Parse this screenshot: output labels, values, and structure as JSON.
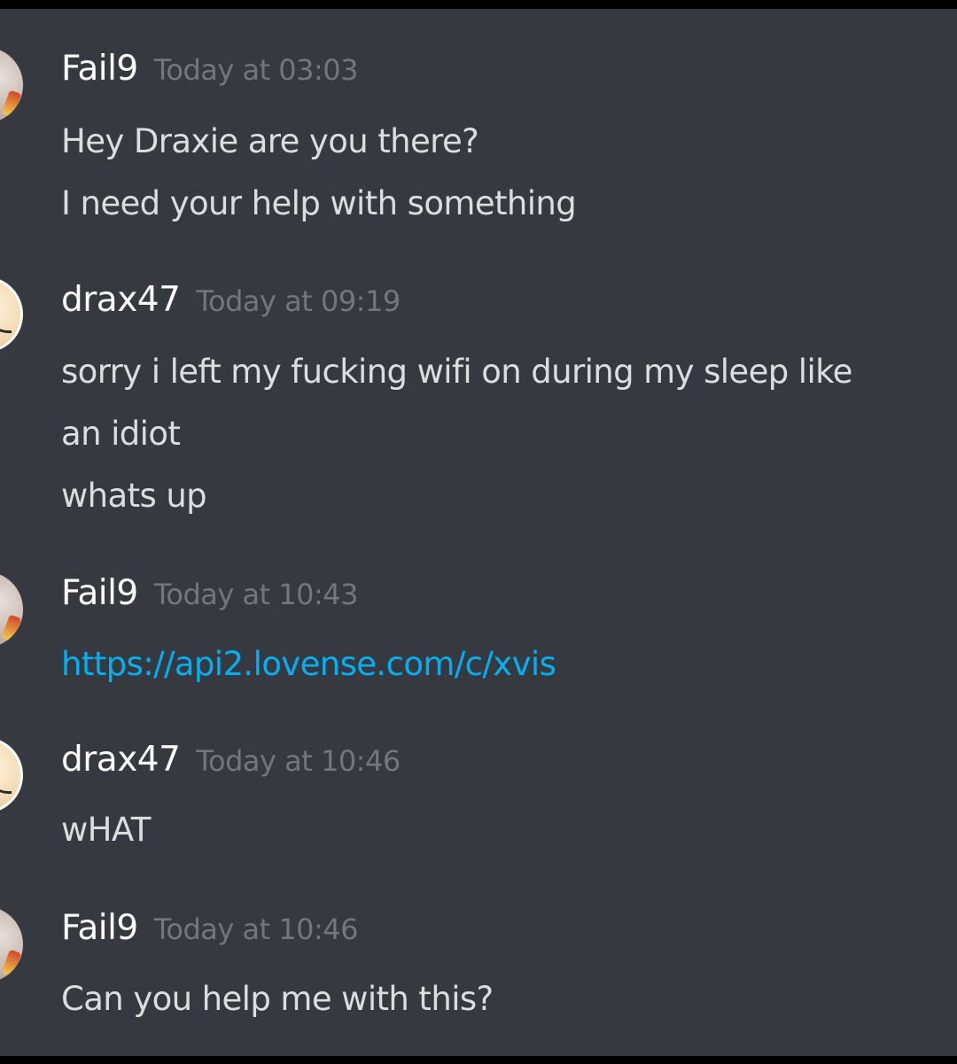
{
  "messages": [
    {
      "username": "Fail9",
      "timestamp": "Today at 03:03",
      "avatar": "user-avatar-fail9",
      "lines": [
        "Hey Draxie are you there?",
        "I need your help with something"
      ]
    },
    {
      "username": "drax47",
      "timestamp": "Today at 09:19",
      "avatar": "user-avatar-drax47",
      "lines": [
        "sorry i left my fucking wifi on during my sleep like",
        "an idiot",
        "whats up"
      ]
    },
    {
      "username": "Fail9",
      "timestamp": "Today at 10:43",
      "avatar": "user-avatar-fail9",
      "lines": [
        "https://api2.lovense.com/c/xvis"
      ]
    },
    {
      "username": "drax47",
      "timestamp": "Today at 10:46",
      "avatar": "user-avatar-drax47",
      "lines": [
        "wHAT"
      ]
    },
    {
      "username": "Fail9",
      "timestamp": "Today at 10:46",
      "avatar": "user-avatar-fail9",
      "lines": [
        "Can you help me with this?"
      ]
    }
  ],
  "colors": {
    "background": "#36393f",
    "username": "#ffffff",
    "timestamp": "#72767d",
    "text": "#dcddde",
    "link": "#00b0f4"
  }
}
